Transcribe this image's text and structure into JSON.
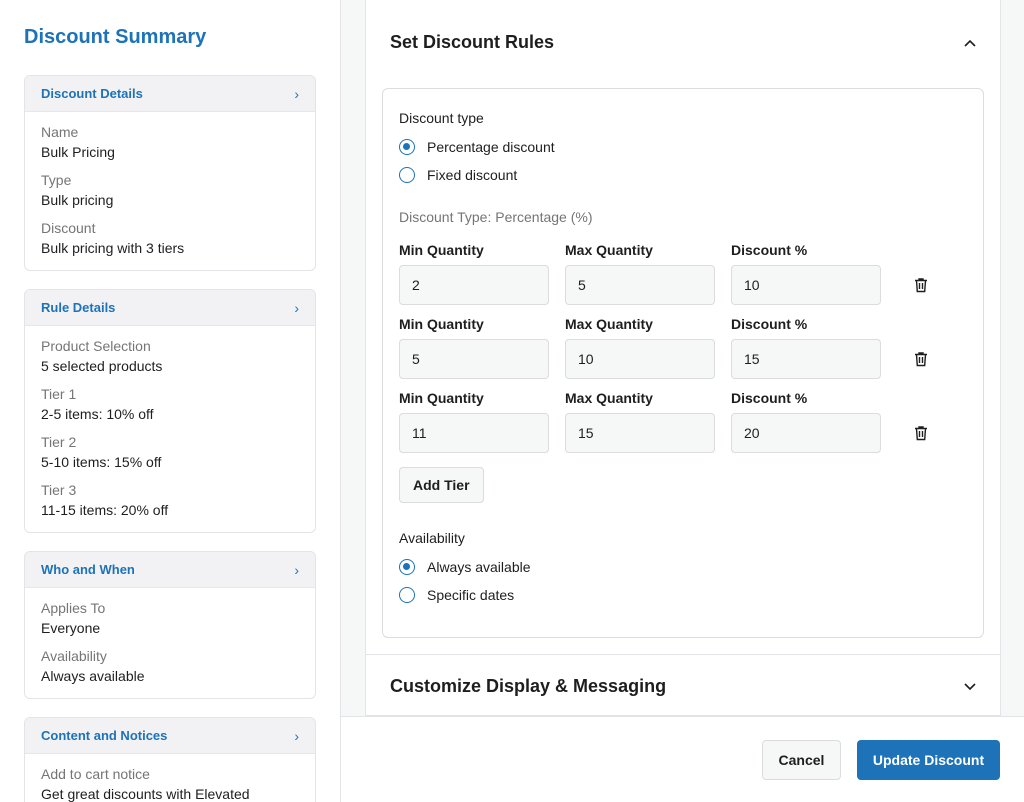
{
  "sidebar": {
    "title": "Discount Summary",
    "cards": [
      {
        "header": "Discount Details",
        "items": [
          {
            "label": "Name",
            "value": "Bulk Pricing"
          },
          {
            "label": "Type",
            "value": "Bulk pricing"
          },
          {
            "label": "Discount",
            "value": "Bulk pricing with 3 tiers"
          }
        ]
      },
      {
        "header": "Rule Details",
        "items": [
          {
            "label": "Product Selection",
            "value": "5 selected products"
          },
          {
            "label": "Tier 1",
            "value": "2-5 items: 10% off"
          },
          {
            "label": "Tier 2",
            "value": "5-10 items: 15% off"
          },
          {
            "label": "Tier 3",
            "value": "11-15 items: 20% off"
          }
        ]
      },
      {
        "header": "Who and When",
        "items": [
          {
            "label": "Applies To",
            "value": "Everyone"
          },
          {
            "label": "Availability",
            "value": "Always available"
          }
        ]
      },
      {
        "header": "Content and Notices",
        "items": [
          {
            "label": "Add to cart notice",
            "value": "Get great discounts with Elevated"
          }
        ]
      }
    ]
  },
  "rules_panel": {
    "title": "Set Discount Rules",
    "discount_type_label": "Discount type",
    "discount_type_options": [
      {
        "label": "Percentage discount",
        "checked": true
      },
      {
        "label": "Fixed discount",
        "checked": false
      }
    ],
    "type_note": "Discount Type: Percentage (%)",
    "column_labels": {
      "min": "Min Quantity",
      "max": "Max Quantity",
      "discount": "Discount %"
    },
    "tiers": [
      {
        "min": "2",
        "max": "5",
        "discount": "10"
      },
      {
        "min": "5",
        "max": "10",
        "discount": "15"
      },
      {
        "min": "11",
        "max": "15",
        "discount": "20"
      }
    ],
    "add_tier_label": "Add Tier",
    "availability_label": "Availability",
    "availability_options": [
      {
        "label": "Always available",
        "checked": true
      },
      {
        "label": "Specific dates",
        "checked": false
      }
    ]
  },
  "display_panel": {
    "title": "Customize Display & Messaging"
  },
  "footer": {
    "cancel_label": "Cancel",
    "update_label": "Update Discount"
  },
  "colors": {
    "accent": "#1d72b8"
  }
}
